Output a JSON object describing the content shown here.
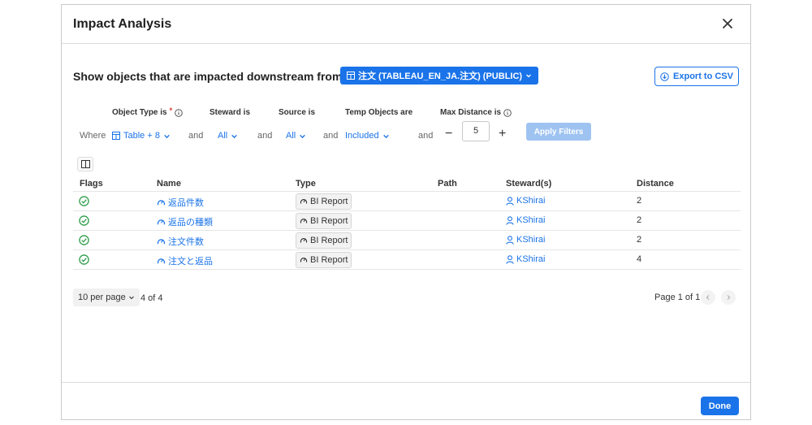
{
  "dialog": {
    "title": "Impact Analysis",
    "heading": "Show objects that are impacted downstream from",
    "object_selector": "注文 (TABLEAU_EN_JA.注文) (PUBLIC)",
    "export_label": "Export to CSV",
    "done_label": "Done"
  },
  "filters": {
    "where": "Where",
    "and": "and",
    "object_type": {
      "label": "Object Type is",
      "required_mark": "*",
      "value": "Table + 8"
    },
    "steward": {
      "label": "Steward is",
      "value": "All"
    },
    "source": {
      "label": "Source is",
      "value": "All"
    },
    "temp": {
      "label": "Temp Objects are",
      "value": "Included"
    },
    "distance": {
      "label": "Max Distance is",
      "value": "5",
      "minus": "−",
      "plus": "+"
    },
    "apply_label": "Apply Filters"
  },
  "table": {
    "headers": [
      "Flags",
      "Name",
      "Type",
      "Path",
      "Steward(s)",
      "Distance"
    ],
    "rows": [
      {
        "name": "返品件数",
        "type": "BI Report",
        "path": "",
        "steward": "KShirai",
        "distance": "2"
      },
      {
        "name": "返品の種類",
        "type": "BI Report",
        "path": "",
        "steward": "KShirai",
        "distance": "2"
      },
      {
        "name": "注文件数",
        "type": "BI Report",
        "path": "",
        "steward": "KShirai",
        "distance": "2"
      },
      {
        "name": "注文と返品",
        "type": "BI Report",
        "path": "",
        "steward": "KShirai",
        "distance": "4"
      }
    ]
  },
  "pagination": {
    "per_page": "10 per page",
    "count": "4 of 4",
    "page_info": "Page 1 of 1"
  },
  "colors": {
    "accent": "#1a73e8",
    "flag_ok": "#2e9e4a",
    "apply_disabled": "#9ec3f1"
  }
}
